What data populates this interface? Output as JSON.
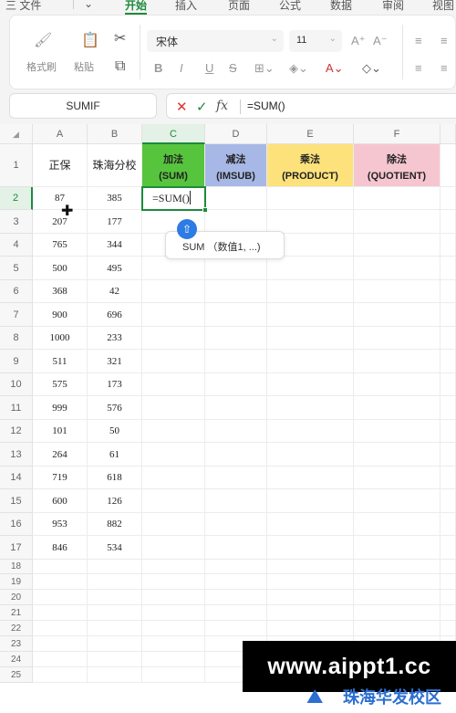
{
  "menu": {
    "file": "三 文件",
    "start": "开始",
    "insert": "插入",
    "page": "页面",
    "formula": "公式",
    "data": "数据",
    "review": "审阅",
    "view": "视图"
  },
  "ribbon": {
    "format_painter": "格式刷",
    "paste": "粘贴",
    "font_name": "宋体",
    "font_size": "11",
    "bold": "B",
    "italic": "I",
    "underline": "U",
    "strike": "S"
  },
  "formula_bar": {
    "name_box": "SUMIF",
    "fx": "fx",
    "content": "=SUM()"
  },
  "grid": {
    "corner": "◢",
    "columns": [
      "A",
      "B",
      "C",
      "D",
      "E",
      "F"
    ],
    "rows": [
      "1",
      "2",
      "3",
      "4",
      "5",
      "6",
      "7",
      "8",
      "9",
      "10",
      "11",
      "12",
      "13",
      "14",
      "15",
      "16",
      "17",
      "18",
      "19",
      "20",
      "21",
      "22",
      "23",
      "24",
      "25"
    ],
    "header_row": {
      "a": "正保",
      "b": "珠海分校",
      "c1": "加法",
      "c2": "(SUM)",
      "d1": "减法",
      "d2": "(IMSUB)",
      "e1": "乘法",
      "e2": "(PRODUCT)",
      "f1": "除法",
      "f2": "(QUOTIENT)"
    },
    "colors": {
      "c": "#57c43d",
      "d": "#a7b8e6",
      "e": "#fde27b",
      "f": "#f6c6d0"
    },
    "data_rows": [
      [
        "87",
        "385"
      ],
      [
        "207",
        "177"
      ],
      [
        "765",
        "344"
      ],
      [
        "500",
        "495"
      ],
      [
        "368",
        "42"
      ],
      [
        "900",
        "696"
      ],
      [
        "1000",
        "233"
      ],
      [
        "511",
        "321"
      ],
      [
        "575",
        "173"
      ],
      [
        "999",
        "576"
      ],
      [
        "101",
        "50"
      ],
      [
        "264",
        "61"
      ],
      [
        "719",
        "618"
      ],
      [
        "600",
        "126"
      ],
      [
        "953",
        "882"
      ],
      [
        "846",
        "534"
      ]
    ],
    "active_cell_text": "=SUM()",
    "tooltip": "SUM （数值1, ...)"
  },
  "watermark": {
    "url": "www.aippt1.cc",
    "school": "珠海华发校区"
  }
}
